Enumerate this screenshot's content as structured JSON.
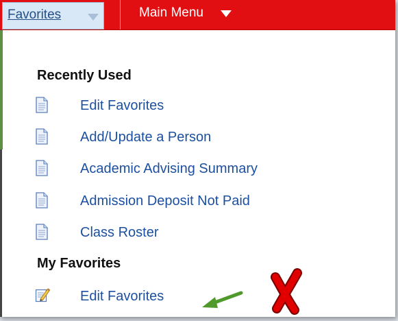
{
  "menubar": {
    "favorites_label": "Favorites",
    "main_menu_label": "Main Menu",
    "bar_color": "#e10f12",
    "favorites_tab_color": "#d8e8f7"
  },
  "recently_used": {
    "heading": "Recently Used",
    "items": [
      {
        "label": "Edit Favorites",
        "icon": "document-icon"
      },
      {
        "label": "Add/Update a Person",
        "icon": "document-icon"
      },
      {
        "label": "Academic Advising Summary",
        "icon": "document-icon"
      },
      {
        "label": "Admission Deposit Not Paid",
        "icon": "document-icon"
      },
      {
        "label": "Class Roster",
        "icon": "document-icon"
      }
    ]
  },
  "my_favorites": {
    "heading": "My Favorites",
    "items": [
      {
        "label": "Edit Favorites",
        "icon": "edit-pencil-icon"
      }
    ]
  },
  "annotations": {
    "arrow_color": "#4f9a2a",
    "x_mark_color": "#e00000"
  }
}
